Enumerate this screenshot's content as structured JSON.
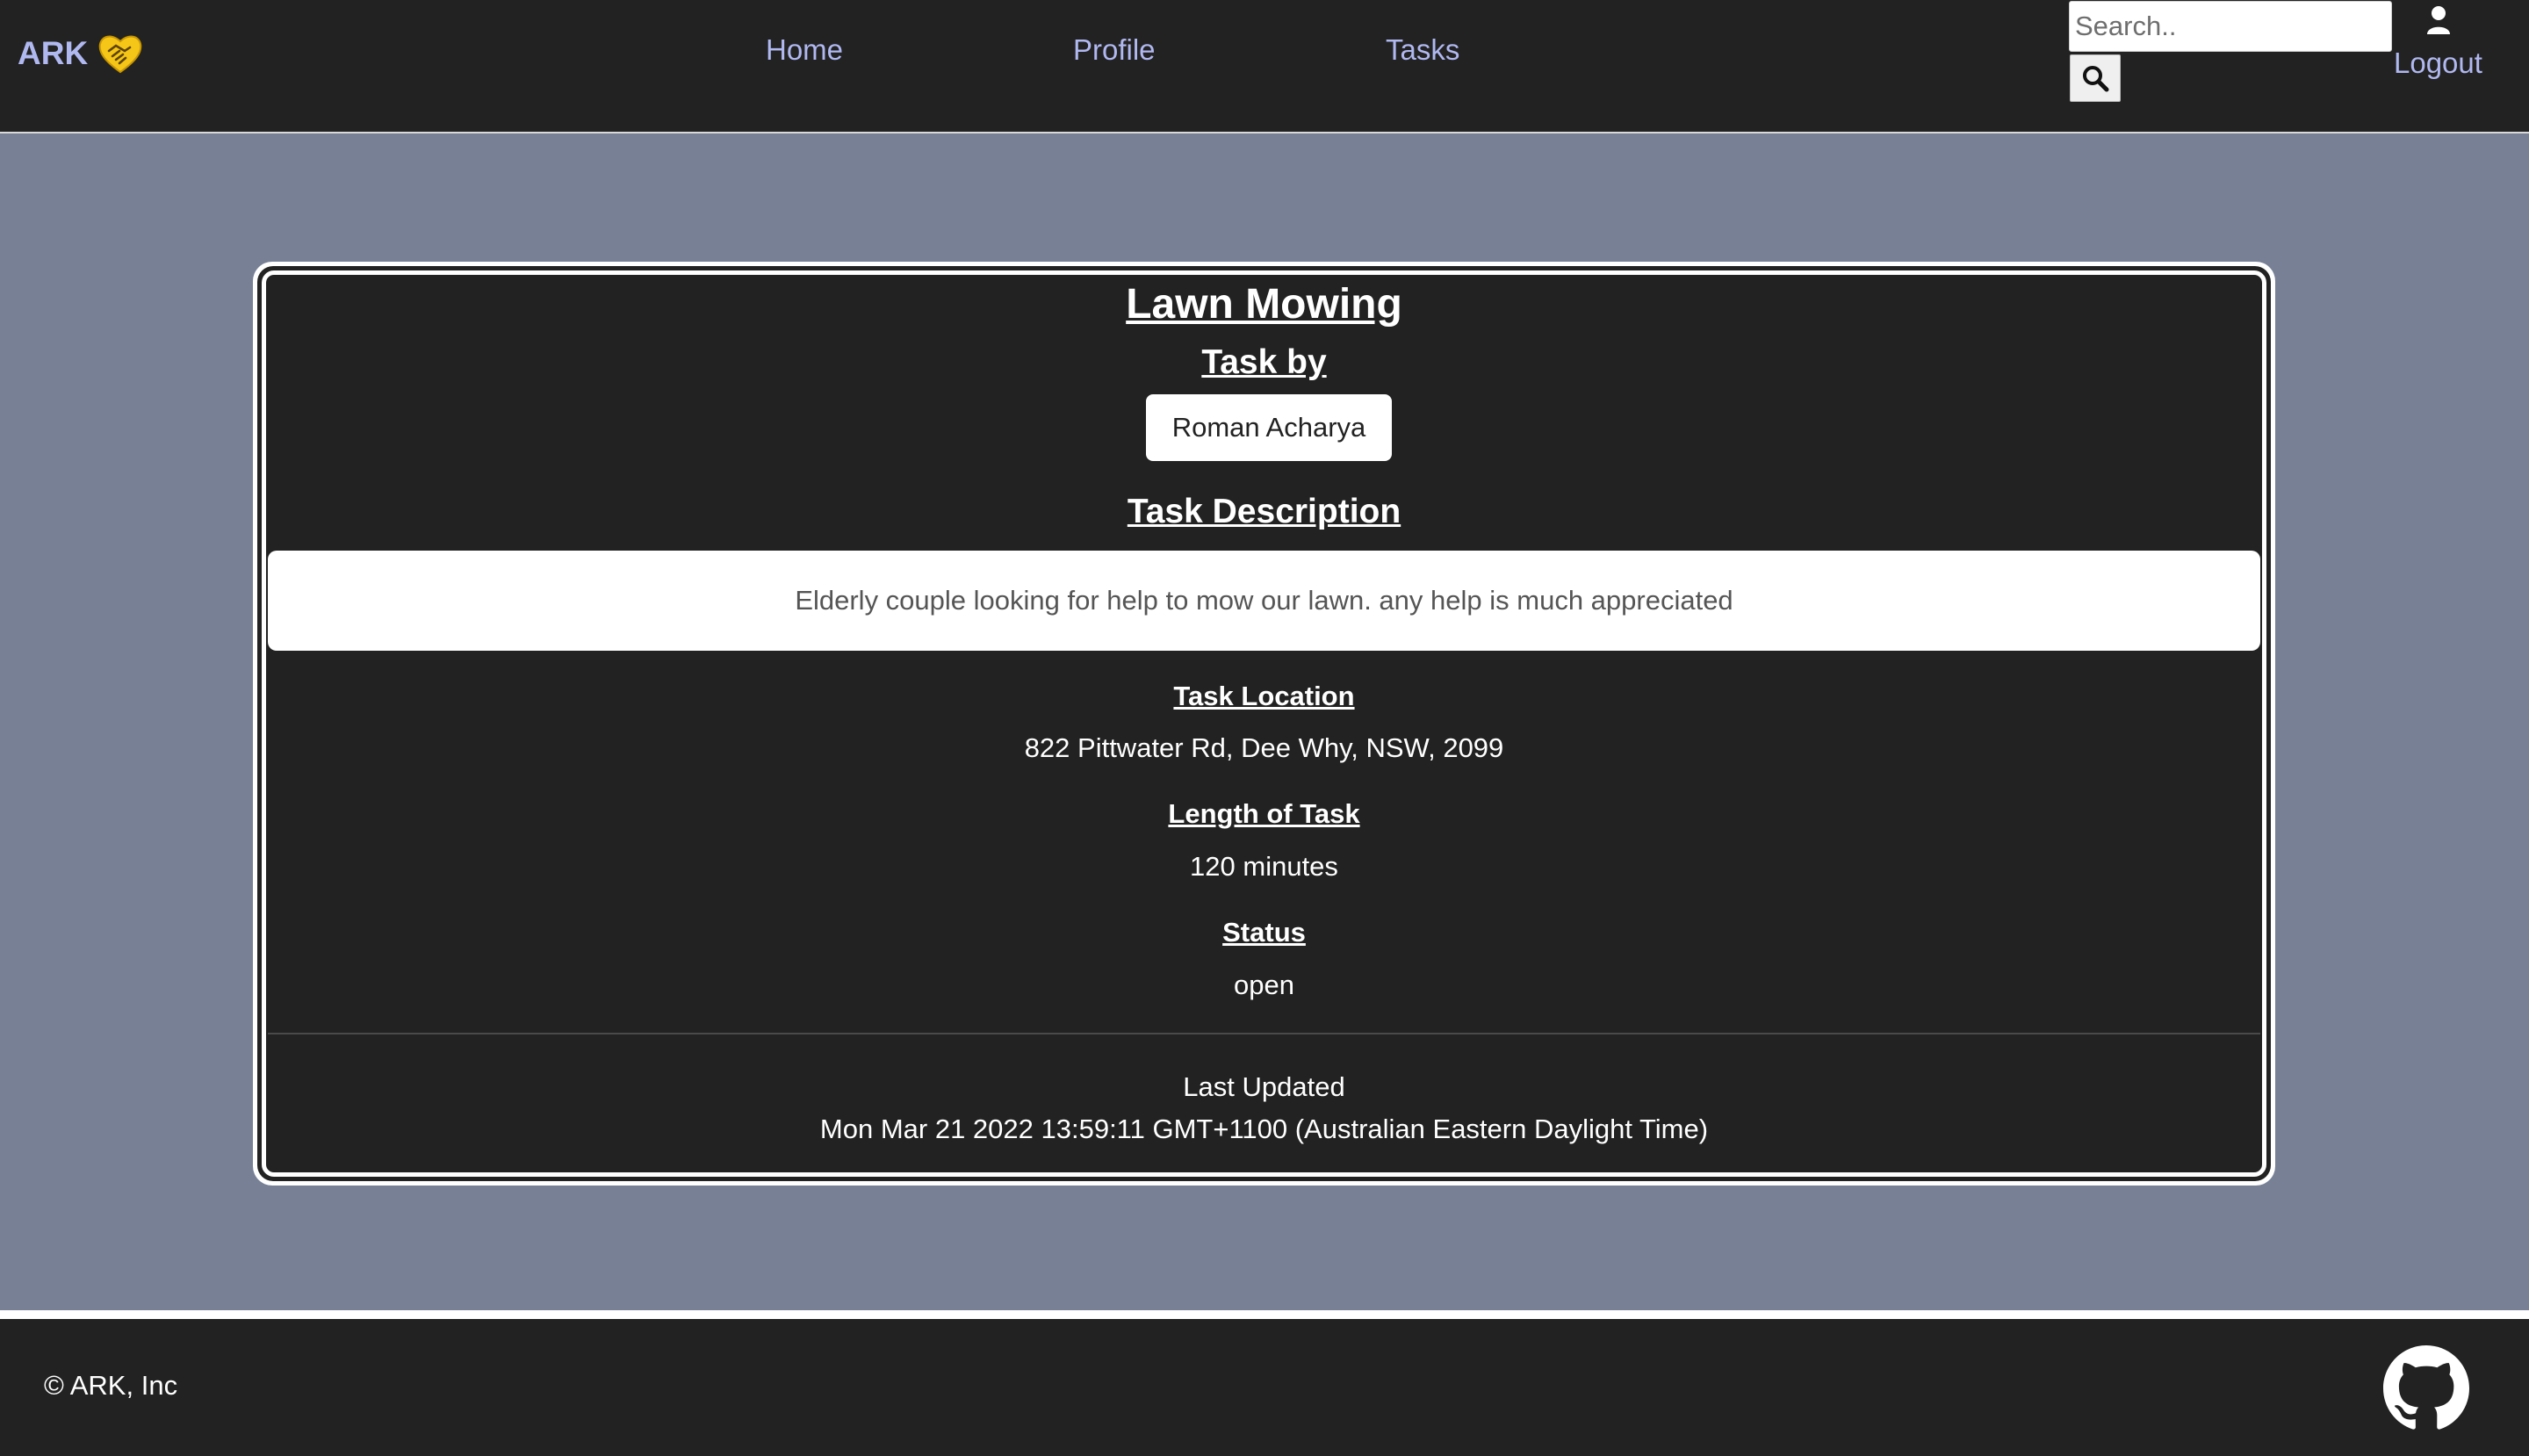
{
  "navbar": {
    "brand": "ARK",
    "links": [
      "Home",
      "Profile",
      "Tasks"
    ],
    "search_placeholder": "Search..",
    "logout": "Logout"
  },
  "task": {
    "title": "Lawn Mowing",
    "task_by_label": "Task by",
    "author": "Roman Acharya",
    "description_label": "Task Description",
    "description": "Elderly couple looking for help to mow our lawn. any help is much appreciated",
    "location_label": "Task Location",
    "location": "822 Pittwater Rd, Dee Why, NSW, 2099",
    "length_label": "Length of Task",
    "length": "120 minutes",
    "status_label": "Status",
    "status": "open",
    "last_updated_label": "Last Updated",
    "last_updated": "Mon Mar 21 2022 13:59:11 GMT+1100 (Australian Eastern Daylight Time)"
  },
  "footer": {
    "copyright": "© ARK, Inc"
  },
  "icons": {
    "logo": "handshake-heart-icon",
    "search": "search-icon",
    "user": "user-icon",
    "github": "github-icon"
  },
  "colors": {
    "nav_bg": "#222222",
    "page_bg": "#788096",
    "link": "#b0b8f0",
    "logo_accent": "#f5c518"
  }
}
